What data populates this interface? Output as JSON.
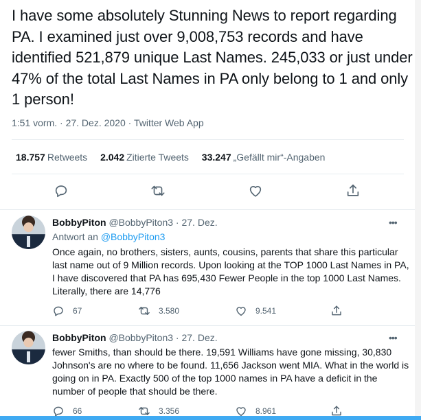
{
  "tweet": {
    "text": "I have some absolutely Stunning News to report regarding PA.  I examined just over 9,008,753 records and have identified 521,879 unique Last Names.  245,033 or just under 47% of the total Last Names in PA only belong to 1 and only 1 person!",
    "meta": "1:51 vorm. · 27. Dez. 2020 · Twitter Web App",
    "stats": {
      "retweets_count": "18.757",
      "retweets_label": "Retweets",
      "quotes_count": "2.042",
      "quotes_label": "Zitierte Tweets",
      "likes_count": "33.247",
      "likes_label": "„Gefällt mir“-Angaben"
    }
  },
  "replies": [
    {
      "name": "BobbyPiton",
      "handle": "@BobbyPiton3",
      "date": " · 27. Dez.",
      "replying_prefix": "Antwort an ",
      "replying_handle": "@BobbyPiton3",
      "text": "Once again, no brothers, sisters, aunts, cousins, parents that share this particular last name out of 9 Million records.  Upon looking at the TOP 1000 Last Names in PA, I have discovered that PA has 695,430 Fewer People in the top 1000 Last Names.  Literally, there are 14,776",
      "reply_count": "67",
      "retweet_count": "3.580",
      "like_count": "9.541"
    },
    {
      "name": "BobbyPiton",
      "handle": "@BobbyPiton3",
      "date": " · 27. Dez.",
      "text": "fewer Smiths, than should be there.  19,591 Williams have gone missing, 30,830 Johnson's are no where to be found.  11,656 Jackson went MIA.  What in the world is going on in PA.  Exactly 500 of the top 1000 names in PA have a deficit in the number of people that should be there.",
      "reply_count": "66",
      "retweet_count": "3.356",
      "like_count": "8.961"
    }
  ],
  "ui": {
    "more_glyph": "•••"
  },
  "colors": {
    "accent": "#1d9bf0",
    "muted": "#536471",
    "text": "#0f1419",
    "border": "#e6ecf0"
  }
}
